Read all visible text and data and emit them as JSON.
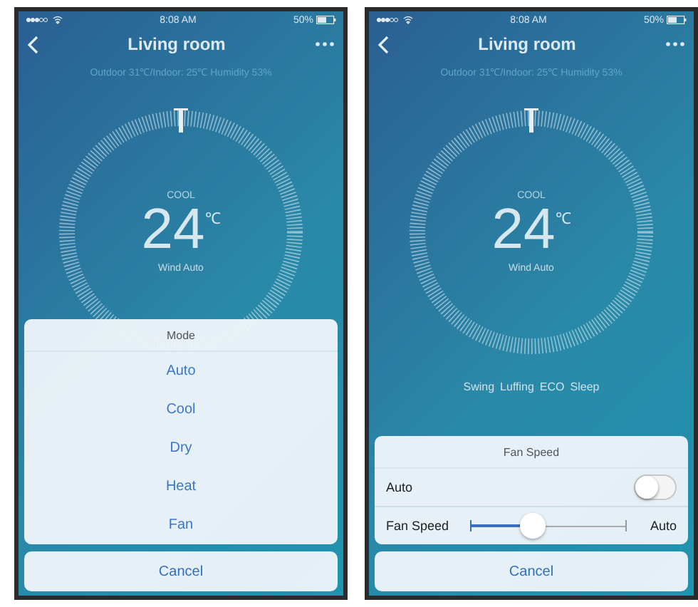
{
  "screens": [
    {
      "status_bar": {
        "time": "8:08 AM",
        "battery": "50%"
      },
      "nav": {
        "title": "Living room"
      },
      "subtitle": "Outdoor 31℃/Indoor: 25℃ Humidity 53%",
      "dial": {
        "mode": "COOL",
        "temperature": "24",
        "unit": "℃",
        "wind": "Wind Auto"
      },
      "sheet": {
        "kind": "list",
        "title": "Mode",
        "options": [
          "Auto",
          "Cool",
          "Dry",
          "Heat",
          "Fan"
        ],
        "cancel": "Cancel"
      }
    },
    {
      "status_bar": {
        "time": "8:08 AM",
        "battery": "50%"
      },
      "nav": {
        "title": "Living room"
      },
      "subtitle": "Outdoor 31℃/Indoor: 25℃ Humidity 53%",
      "dial": {
        "mode": "COOL",
        "temperature": "24",
        "unit": "℃",
        "wind": "Wind Auto"
      },
      "features": [
        "Swing",
        "Luffing",
        "ECO",
        "Sleep"
      ],
      "sheet": {
        "kind": "settings",
        "title": "Fan Speed",
        "toggle": {
          "label": "Auto",
          "on": false
        },
        "slider": {
          "label": "Fan Speed",
          "level": 0.4,
          "end_label": "Auto"
        },
        "cancel": "Cancel"
      }
    }
  ]
}
